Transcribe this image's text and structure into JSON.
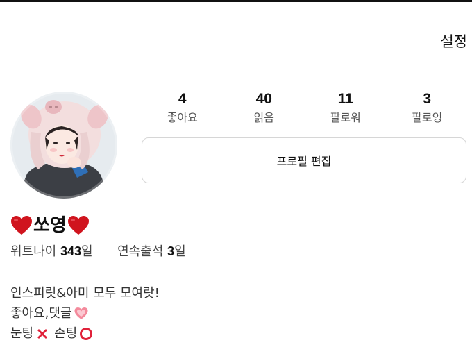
{
  "header": {
    "settings_label": "설정"
  },
  "profile": {
    "name": "쏘영",
    "stats": [
      {
        "count": "4",
        "label": "좋아요"
      },
      {
        "count": "40",
        "label": "읽음"
      },
      {
        "count": "11",
        "label": "팔로워"
      },
      {
        "count": "3",
        "label": "팔로잉"
      }
    ],
    "edit_button_label": "프로필 편집",
    "meta": {
      "age_label": "위트나이",
      "age_value": "343",
      "age_unit": "일",
      "streak_label": "연속출석",
      "streak_value": "3",
      "streak_unit": "일"
    },
    "bio": {
      "line1": "인스피릿&아미 모두 모여랏!",
      "line2": "좋아요,댓글",
      "line3": "눈팅",
      "line3b": "손팅"
    }
  },
  "icons": {
    "name_hearts": "red-heart-icon",
    "line2_emoji": "heart-pink-icon",
    "line3_no": "cross-mark-icon",
    "line3_yes": "circle-mark-icon"
  }
}
